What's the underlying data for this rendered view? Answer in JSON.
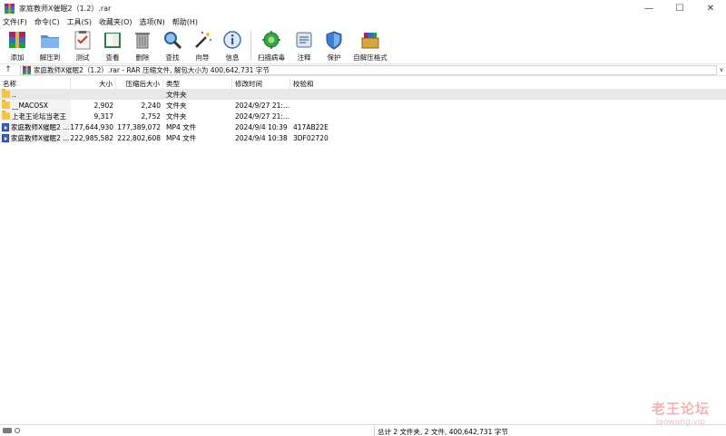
{
  "window": {
    "title": "家庭教师X催眠2（1.2）.rar",
    "controls": [
      "—",
      "☐",
      "✕"
    ]
  },
  "menu": [
    "文件(F)",
    "命令(C)",
    "工具(S)",
    "收藏夹(O)",
    "选项(N)",
    "帮助(H)"
  ],
  "toolbar": {
    "add": "添加",
    "extract": "解压到",
    "test": "测试",
    "view": "查看",
    "delete": "删除",
    "find": "查找",
    "wizard": "向导",
    "info": "信息",
    "virus": "扫描病毒",
    "comment": "注释",
    "protect": "保护",
    "sfx": "自解压格式"
  },
  "address": {
    "up": "↑",
    "path": "家庭教师X催眠2（1.2）.rar - RAR 压缩文件, 解包大小为 400,642,731 字节",
    "arrow": "∨"
  },
  "columns": {
    "name": "名称",
    "size": "大小",
    "packed": "压缩后大小",
    "type": "类型",
    "modified": "修改时间",
    "crc": "校验和"
  },
  "files": [
    {
      "name": "..",
      "size": "",
      "packed": "",
      "type": "文件夹",
      "modified": "",
      "crc": "",
      "icon": "folder"
    },
    {
      "name": "__MACOSX",
      "size": "2,902",
      "packed": "2,240",
      "type": "文件夹",
      "modified": "2024/9/27 21:...",
      "crc": "",
      "icon": "folder"
    },
    {
      "name": "上老王论坛当老王",
      "size": "9,317",
      "packed": "2,752",
      "type": "文件夹",
      "modified": "2024/9/27 21:...",
      "crc": "",
      "icon": "folder"
    },
    {
      "name": "家庭教师X催眠2 ...",
      "size": "177,644,930",
      "packed": "177,389,072",
      "type": "MP4 文件",
      "modified": "2024/9/4 10:39",
      "crc": "417AB22E",
      "icon": "mp4"
    },
    {
      "name": "家庭教师X催眠2 ...",
      "size": "222,985,582",
      "packed": "222,802,608",
      "type": "MP4 文件",
      "modified": "2024/9/4 10:38",
      "crc": "3DF02720",
      "icon": "mp4"
    }
  ],
  "status": {
    "summary": "总计 2 文件夹, 2 文件, 400,642,731 字节"
  },
  "watermark": {
    "main": "老王论坛",
    "url": "laowang.vip"
  },
  "colors": {
    "folder": "#f3c54a",
    "mp4": "#3d63b4",
    "selected_row": "#e8e8e8"
  }
}
